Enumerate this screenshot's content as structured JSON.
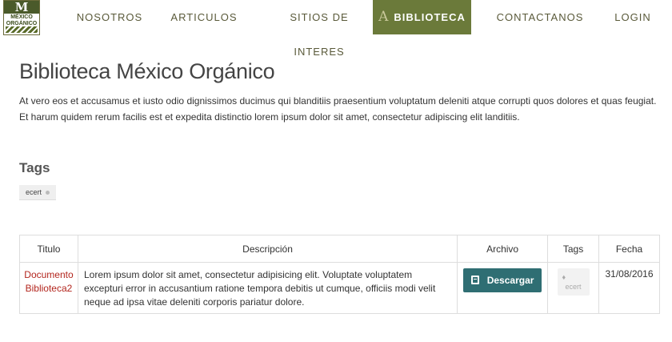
{
  "header": {
    "logo": {
      "big_letter": "M",
      "line1": "MÉXICO",
      "line2": "ORGÁNICO"
    },
    "nav": [
      {
        "label": "NOSOTROS",
        "active": false
      },
      {
        "label": "ARTICULOS",
        "active": false
      },
      {
        "label": "SITIOS DE INTERES",
        "active": false
      },
      {
        "label": "BIBLIOTECA",
        "active": true,
        "icon_glyph": "A"
      },
      {
        "label": "CONTACTANOS",
        "active": false
      },
      {
        "label": "LOGIN",
        "active": false
      }
    ]
  },
  "main": {
    "title": "Biblioteca México Orgánico",
    "intro": "At vero eos et accusamus et iusto odio dignissimos ducimus qui blanditiis praesentium voluptatum deleniti atque corrupti quos dolores et quas feugiat. Et harum quidem rerum facilis est et expedita distinctio lorem ipsum dolor sit amet, consectetur adipiscing elit landitiis.",
    "tags_heading": "Tags",
    "tags": [
      "ecert"
    ]
  },
  "table": {
    "headers": [
      "Titulo",
      "Descripción",
      "Archivo",
      "Tags",
      "Fecha"
    ],
    "rows": [
      {
        "title": "Documento Biblioteca2",
        "description": "Lorem ipsum dolor sit amet, consectetur adipisicing elit. Voluptate voluptatem excepturi error in accusantium ratione tempora debitis ut cumque, officiis modi velit neque ad ipsa vitae deleniti corporis pariatur dolore.",
        "file_button": "Descargar",
        "tag": "ecert",
        "date": "31/08/2016"
      }
    ]
  },
  "colors": {
    "nav_active_bg": "#6b7a3a",
    "link_red": "#b3261e",
    "button_teal": "#2f6e73"
  },
  "icons": {
    "logo": "mexico-organico-logo",
    "active_nav": "letter-a-icon",
    "tag_pill": "dot-icon",
    "download": "book-icon",
    "tag_chip": "tag-icon"
  }
}
